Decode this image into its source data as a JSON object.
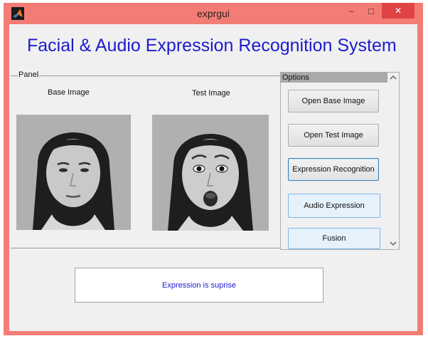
{
  "window": {
    "title": "exprgui",
    "controls": {
      "minimize": "–",
      "maximize": "□",
      "close": "✕"
    },
    "icon": "matlab-icon"
  },
  "heading": "Facial & Audio Expression Recognition System",
  "panel": {
    "label": "Panel",
    "base_label": "Base Image",
    "test_label": "Test Image",
    "base_image_icon": "face-photo-neutral",
    "test_image_icon": "face-photo-surprise"
  },
  "options": {
    "title": "Options",
    "buttons": [
      {
        "label": "Open Base Image"
      },
      {
        "label": "Open Test Image"
      },
      {
        "label": "Expression Recognition"
      },
      {
        "label": "Audio Expression"
      },
      {
        "label": "Fusion"
      }
    ]
  },
  "result": "Expression is suprise",
  "colors": {
    "title_bar": "#f37d74",
    "close_button": "#e04343",
    "heading": "#1c1ccd",
    "result_text": "#1c1ccd"
  }
}
